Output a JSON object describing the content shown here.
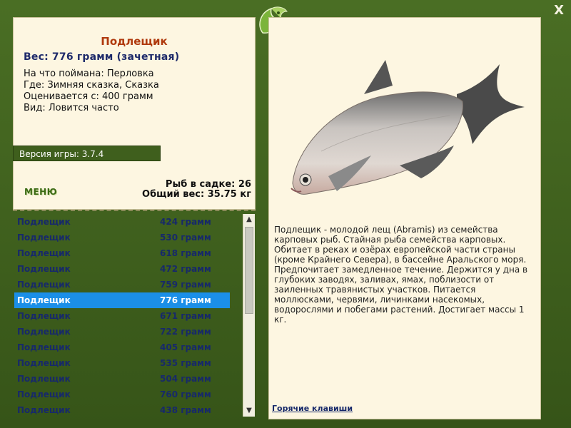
{
  "fish": {
    "title": "Подлещик",
    "weight": "Вес: 776 грамм (зачетная)",
    "caught_on": "На что поймана: Перловка",
    "where": "Где: Зимняя сказка, Сказка",
    "valued_from": "Оценивается с: 400 грамм",
    "kind": "Вид: Ловится часто"
  },
  "version": "Версия игры: 3.7.4",
  "menu_label": "МЕНЮ",
  "stats": {
    "count": "Рыб в садке: 26",
    "total": "Общий вес: 35.75 кг"
  },
  "list": [
    {
      "name": "Подлещик",
      "weight": "424 грамм"
    },
    {
      "name": "Подлещик",
      "weight": "530 грамм"
    },
    {
      "name": "Подлещик",
      "weight": "618 грамм"
    },
    {
      "name": "Подлещик",
      "weight": "472 грамм"
    },
    {
      "name": "Подлещик",
      "weight": "759 грамм"
    },
    {
      "name": "Подлещик",
      "weight": "776 грамм"
    },
    {
      "name": "Подлещик",
      "weight": "671 грамм"
    },
    {
      "name": "Подлещик",
      "weight": "722 грамм"
    },
    {
      "name": "Подлещик",
      "weight": "405 грамм"
    },
    {
      "name": "Подлещик",
      "weight": "535 грамм"
    },
    {
      "name": "Подлещик",
      "weight": "504 грамм"
    },
    {
      "name": "Подлещик",
      "weight": "760 грамм"
    },
    {
      "name": "Подлещик",
      "weight": "438 грамм"
    }
  ],
  "selected_index": 5,
  "description": "Подлещик - молодой лещ (Abramis) из семейства карповых рыб. Стайная рыба семейства карповых. Обитает в реках и озёрах европейской части страны (кроме Крайнего Севера), в бассейне Аральского моря. Предпочитает замедленное течение. Держится у дна в глубоких заводях, заливах, ямах, поблизости от заиленных травянистых участков. Питается моллюсками, червями, личинками насекомых, водорослями и побегами растений. Достигает массы 1 кг.",
  "hotkeys_label": "Горячие клавиши",
  "close_label": "X",
  "icons": {
    "close": "close-icon",
    "emblem": "leaf-emblem-icon",
    "scroll_up": "chevron-up-icon",
    "scroll_down": "chevron-down-icon"
  }
}
